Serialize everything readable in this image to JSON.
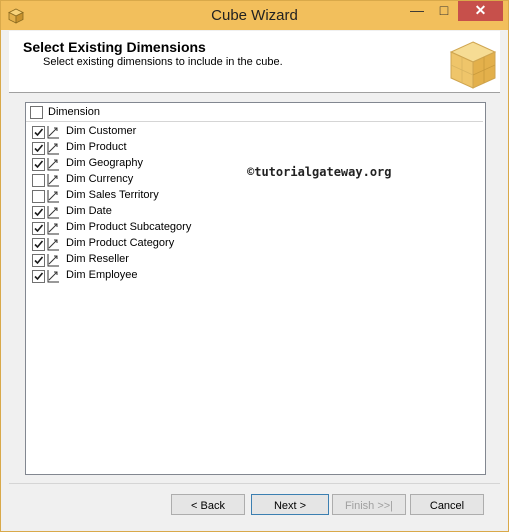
{
  "window": {
    "title": "Cube Wizard",
    "min_glyph": "—",
    "max_glyph": "□",
    "close_glyph": "✕"
  },
  "header": {
    "title": "Select Existing Dimensions",
    "subtitle": "Select existing dimensions to include in the cube."
  },
  "grid": {
    "column_header": "Dimension",
    "header_checked": false,
    "rows": [
      {
        "label": "Dim Customer",
        "checked": true
      },
      {
        "label": "Dim Product",
        "checked": true
      },
      {
        "label": "Dim Geography",
        "checked": true
      },
      {
        "label": "Dim Currency",
        "checked": false
      },
      {
        "label": "Dim Sales Territory",
        "checked": false
      },
      {
        "label": "Dim Date",
        "checked": true
      },
      {
        "label": "Dim Product Subcategory",
        "checked": true
      },
      {
        "label": "Dim Product Category",
        "checked": true
      },
      {
        "label": "Dim Reseller",
        "checked": true
      },
      {
        "label": "Dim Employee",
        "checked": true
      }
    ]
  },
  "watermark": "©tutorialgateway.org",
  "buttons": {
    "back": "< Back",
    "next": "Next >",
    "finish": "Finish >>|",
    "cancel": "Cancel"
  },
  "colors": {
    "titlebar": "#f2bf5c",
    "close": "#c7504b"
  }
}
